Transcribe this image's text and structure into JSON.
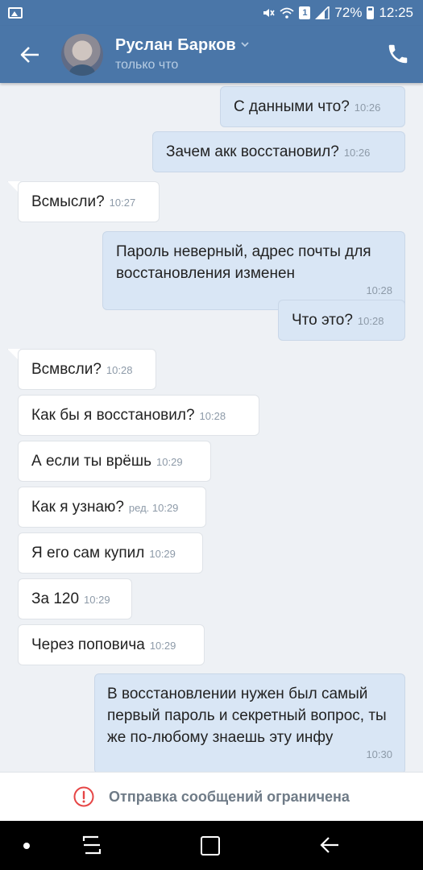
{
  "status_bar": {
    "battery": "72%",
    "time": "12:25",
    "sim_slot": "1",
    "icons": [
      "image-icon",
      "mute-icon",
      "wifi-icon",
      "sim-icon",
      "signal-icon",
      "battery-icon"
    ]
  },
  "header": {
    "contact_name": "Руслан Барков",
    "status": "только что",
    "icons": [
      "back-arrow-icon",
      "avatar",
      "chevron-down-icon",
      "phone-icon"
    ],
    "colors": {
      "bar": "#4a76a8",
      "subtitle": "#b8cde3"
    }
  },
  "messages": [
    {
      "dir": "out",
      "text": "С данными что?",
      "time": "10:26"
    },
    {
      "dir": "out",
      "text": "Зачем акк восстановил?",
      "time": "10:26"
    },
    {
      "dir": "in",
      "text": "Всмысли?",
      "time": "10:27"
    },
    {
      "dir": "out",
      "text": "Пароль неверный, адрес почты для восстановления изменен",
      "time": "10:28"
    },
    {
      "dir": "out",
      "text": "Что это?",
      "time": "10:28"
    },
    {
      "dir": "in",
      "text": "Всмвсли?",
      "time": "10:28"
    },
    {
      "dir": "in",
      "text": "Как бы я восстановил?",
      "time": "10:28"
    },
    {
      "dir": "in",
      "text": "А если ты врёшь",
      "time": "10:29"
    },
    {
      "dir": "in",
      "text": "Как я узнаю?",
      "time": "ред. 10:29"
    },
    {
      "dir": "in",
      "text": "Я его сам купил",
      "time": "10:29"
    },
    {
      "dir": "in",
      "text": "За 120",
      "time": "10:29"
    },
    {
      "dir": "in",
      "text": "Через поповича",
      "time": "10:29"
    },
    {
      "dir": "out",
      "text": "В восстановлении нужен был самый первый пароль и секретный вопрос, ты же по-любому знаешь эту инфу",
      "time": "10:30"
    }
  ],
  "restriction": {
    "text": "Отправка сообщений ограничена",
    "icon": "warning-icon",
    "color": "#e64646"
  },
  "nav_bar": {
    "icons": [
      "nav-dot-icon",
      "recent-apps-icon",
      "home-icon",
      "back-icon"
    ]
  }
}
